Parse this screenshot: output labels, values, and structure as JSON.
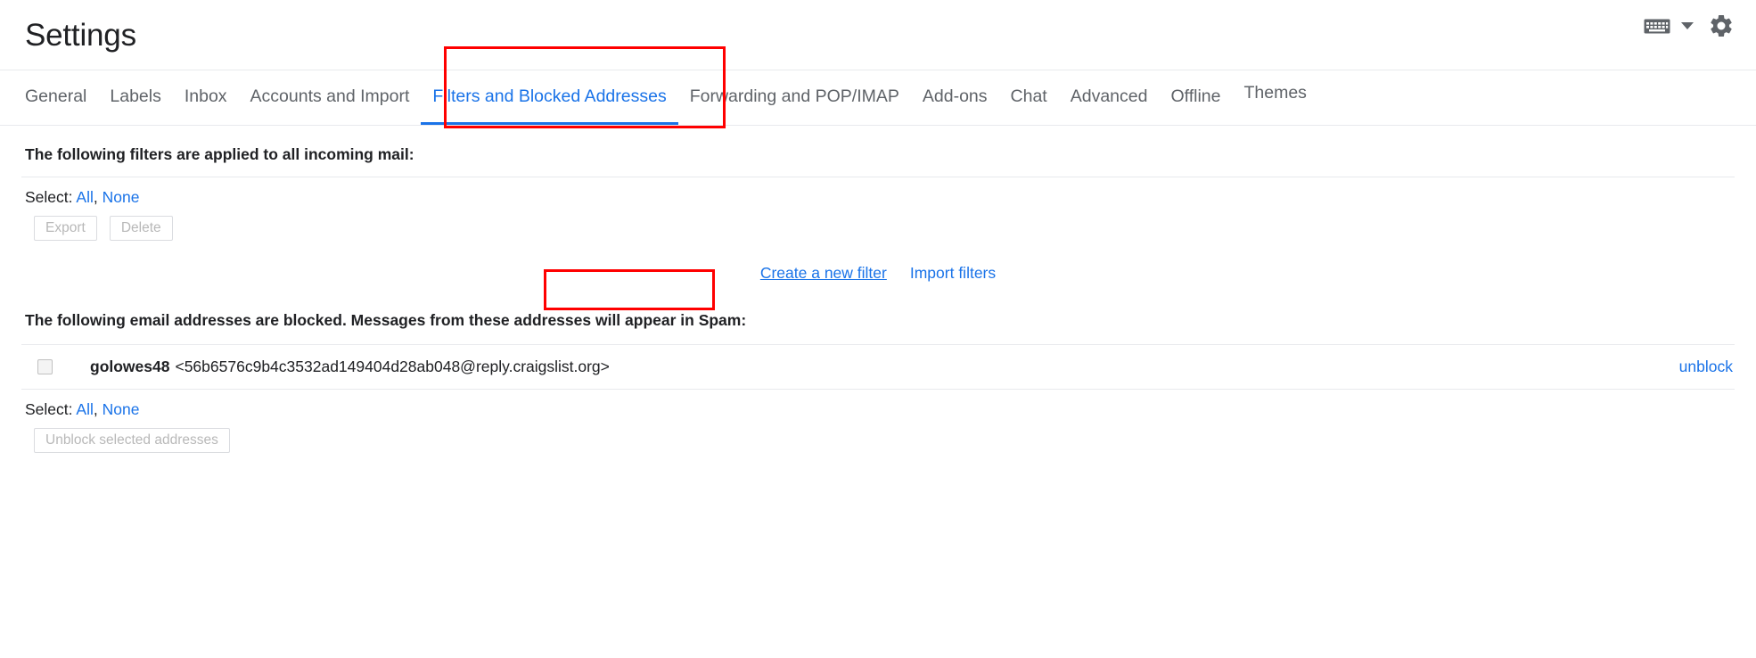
{
  "header": {
    "title": "Settings",
    "keyboard_icon": "keyboard-icon",
    "chevron_icon": "chevron-down-icon",
    "gear_icon": "gear-icon"
  },
  "tabs": [
    {
      "label": "General",
      "active": false
    },
    {
      "label": "Labels",
      "active": false
    },
    {
      "label": "Inbox",
      "active": false
    },
    {
      "label": "Accounts and Import",
      "active": false
    },
    {
      "label": "Filters and Blocked Addresses",
      "active": true
    },
    {
      "label": "Forwarding and POP/IMAP",
      "active": false
    },
    {
      "label": "Add-ons",
      "active": false
    },
    {
      "label": "Chat",
      "active": false
    },
    {
      "label": "Advanced",
      "active": false
    },
    {
      "label": "Offline",
      "active": false
    },
    {
      "label": "Themes",
      "active": false
    }
  ],
  "filters_section": {
    "heading": "The following filters are applied to all incoming mail:",
    "select_label": "Select:",
    "select_all": "All",
    "select_separator": ",",
    "select_none": "None",
    "export_button": "Export",
    "delete_button": "Delete",
    "create_filter_link": "Create a new filter",
    "import_filters_link": "Import filters"
  },
  "blocked_section": {
    "heading": "The following email addresses are blocked. Messages from these addresses will appear in Spam:",
    "rows": [
      {
        "name": "golowes48",
        "address": "<56b6576c9b4c3532ad149404d28ab048@reply.craigslist.org>",
        "action": "unblock",
        "checked": false
      }
    ],
    "select_label": "Select:",
    "select_all": "All",
    "select_separator": ",",
    "select_none": "None",
    "unblock_button": "Unblock selected addresses"
  },
  "colors": {
    "accent_blue": "#1a73e8",
    "annotation_red": "#ff0000",
    "text_primary": "#202124",
    "text_secondary": "#5f6368",
    "disabled_text": "#b8b8b8",
    "divider": "#e8eaed"
  }
}
